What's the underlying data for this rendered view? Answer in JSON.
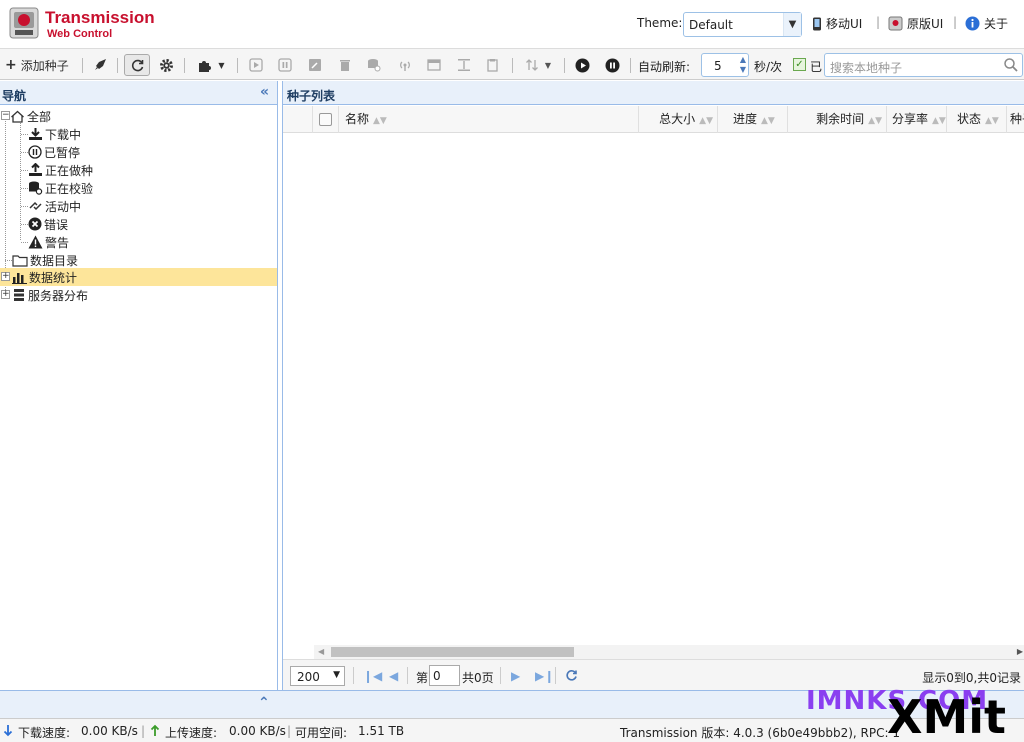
{
  "header": {
    "logo_title": "Transmission",
    "logo_subtitle": "Web Control",
    "theme_label": "Theme:",
    "theme_value": "Default",
    "links": [
      {
        "label": "移动UI",
        "icon": "mobile-icon"
      },
      {
        "label": "原版UI",
        "icon": "original-ui-icon"
      },
      {
        "label": "关于",
        "icon": "info-icon"
      }
    ],
    "separator": "|"
  },
  "toolbar": {
    "add_torrent_label": "添加种子",
    "auto_refresh_label": "自动刷新:",
    "auto_refresh_value": "5",
    "auto_refresh_unit": "秒/次",
    "auto_refresh_checkbox_label": "已",
    "search_placeholder": "搜索本地种子"
  },
  "nav": {
    "title": "导航",
    "items": [
      {
        "label": "全部",
        "icon": "home-icon"
      },
      {
        "label": "下载中",
        "icon": "download-icon"
      },
      {
        "label": "已暂停",
        "icon": "pause-icon"
      },
      {
        "label": "正在做种",
        "icon": "upload-icon"
      },
      {
        "label": "正在校验",
        "icon": "check-icon"
      },
      {
        "label": "活动中",
        "icon": "active-icon"
      },
      {
        "label": "错误",
        "icon": "error-icon"
      },
      {
        "label": "警告",
        "icon": "warning-icon"
      },
      {
        "label": "数据目录",
        "icon": "folder-icon"
      },
      {
        "label": "数据统计",
        "icon": "stats-icon"
      },
      {
        "label": "服务器分布",
        "icon": "server-icon"
      }
    ]
  },
  "list": {
    "title": "种子列表",
    "columns": [
      "名称",
      "总大小",
      "进度",
      "剩余时间",
      "分享率",
      "状态",
      "种子"
    ],
    "rows": []
  },
  "pager": {
    "page_size": "200",
    "page_label": "第",
    "page_value": "0",
    "page_total": "共0页",
    "summary": "显示0到0,共0记录"
  },
  "status": {
    "download_label": "下载速度:",
    "download_value": "0.00 KB/s",
    "upload_label": "上传速度:",
    "upload_value": "0.00 KB/s",
    "free_label": "可用空间:",
    "free_value": "1.51 TB",
    "version_text": "Transmission 版本: 4.0.3 (6b0e49bbb2), RPC: 1"
  },
  "watermark": {
    "top": "IMNKS.COM",
    "bottom": "XMit"
  },
  "colors": {
    "brand": "#c8102e",
    "panel_header": "#e8f0fa",
    "selected_row": "#fde59a",
    "border_blue": "#99bbe8"
  }
}
